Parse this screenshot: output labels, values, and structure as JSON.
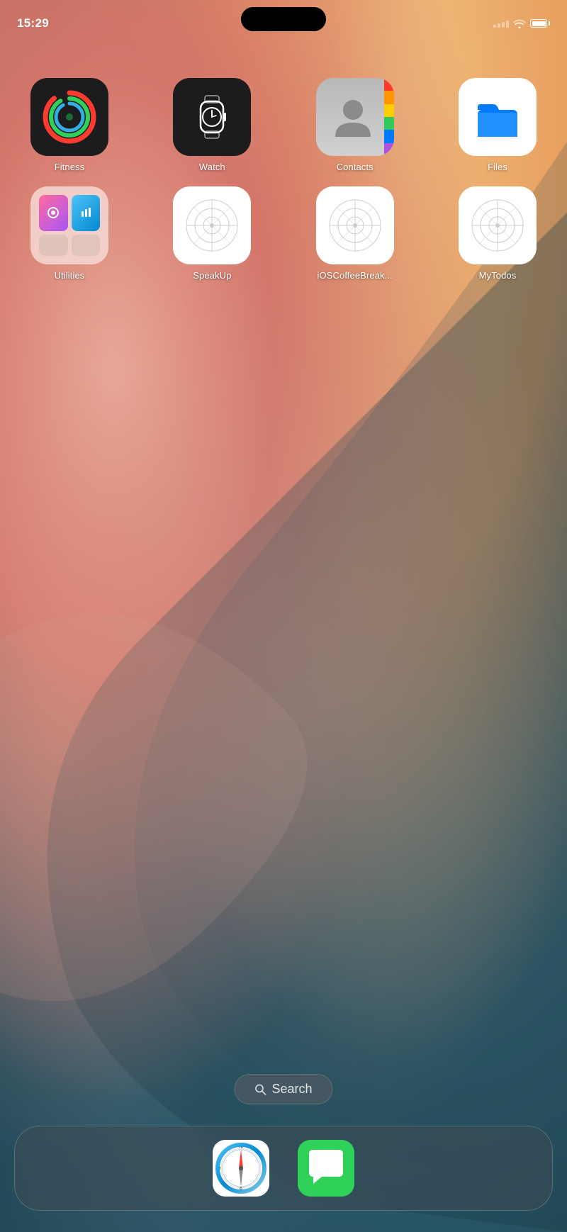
{
  "status_bar": {
    "time": "15:29",
    "wifi": true,
    "battery_full": true
  },
  "apps": {
    "row1": [
      {
        "id": "fitness",
        "label": "Fitness",
        "icon_type": "fitness"
      },
      {
        "id": "watch",
        "label": "Watch",
        "icon_type": "watch"
      },
      {
        "id": "contacts",
        "label": "Contacts",
        "icon_type": "contacts"
      },
      {
        "id": "files",
        "label": "Files",
        "icon_type": "files"
      }
    ],
    "row2": [
      {
        "id": "utilities",
        "label": "Utilities",
        "icon_type": "utilities"
      },
      {
        "id": "speakup",
        "label": "SpeakUp",
        "icon_type": "default"
      },
      {
        "id": "ioscoffeebreak",
        "label": "iOSCoffeeBreak...",
        "icon_type": "default"
      },
      {
        "id": "mytodos",
        "label": "MyTodos",
        "icon_type": "default"
      }
    ]
  },
  "search": {
    "label": "Search",
    "placeholder": "Search"
  },
  "dock": {
    "apps": [
      {
        "id": "safari",
        "label": "Safari",
        "icon_type": "safari"
      },
      {
        "id": "messages",
        "label": "Messages",
        "icon_type": "messages"
      }
    ]
  }
}
